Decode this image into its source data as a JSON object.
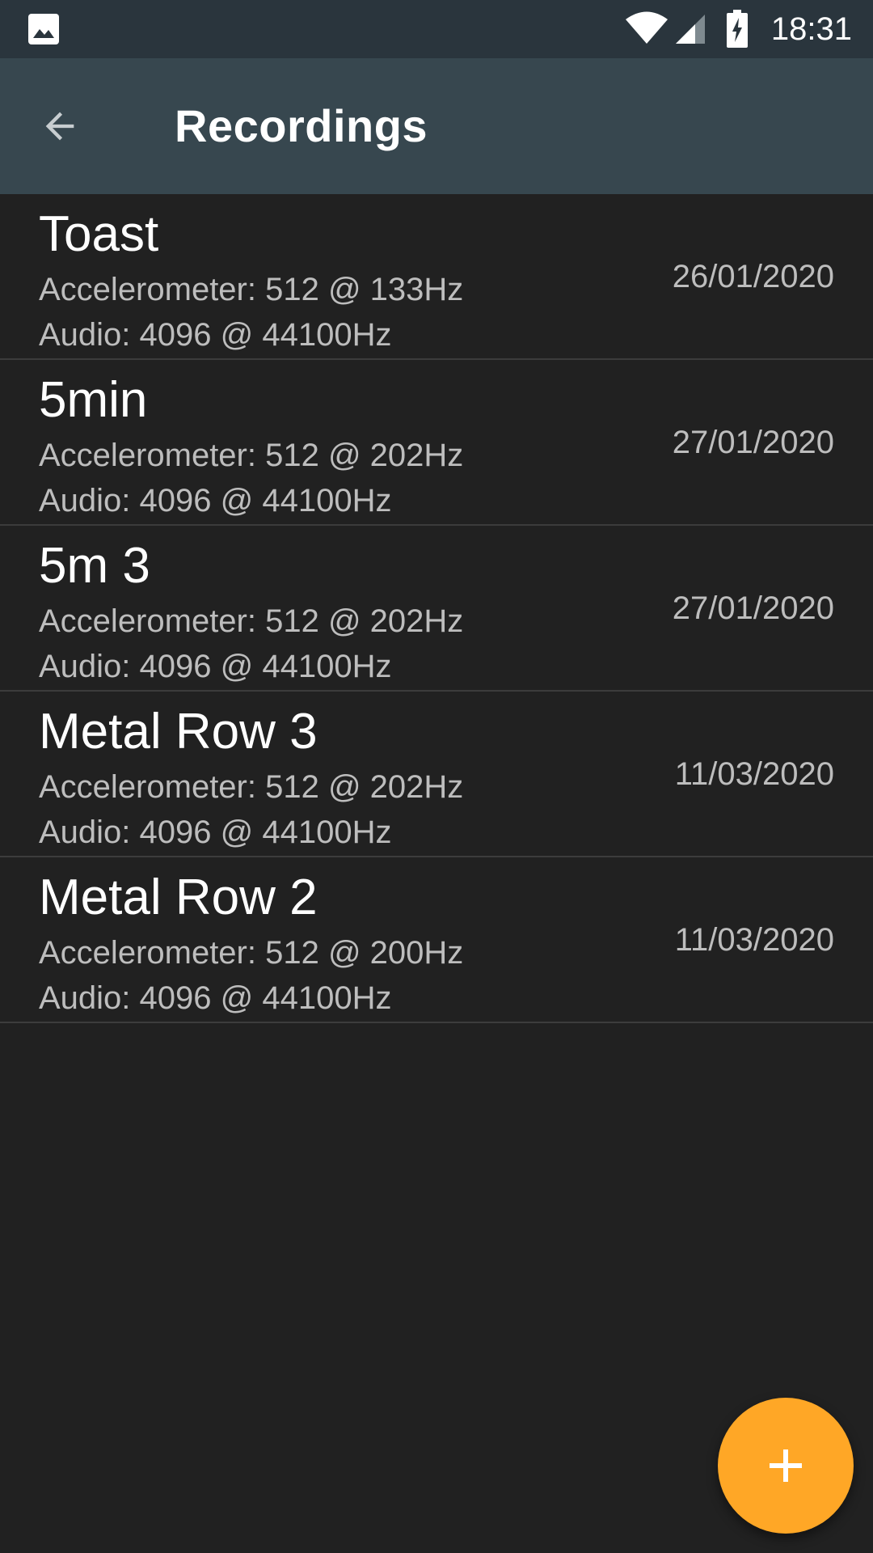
{
  "status_bar": {
    "time": "18:31",
    "icons": [
      "gallery-icon",
      "wifi-icon",
      "signal-icon",
      "battery-charging-icon"
    ]
  },
  "app_bar": {
    "title": "Recordings",
    "back_icon": "arrow-back-icon"
  },
  "recordings": [
    {
      "name": "Toast",
      "accelerometer": "Accelerometer: 512 @ 133Hz",
      "audio": "Audio: 4096 @ 44100Hz",
      "date": "26/01/2020"
    },
    {
      "name": "5min",
      "accelerometer": "Accelerometer: 512 @ 202Hz",
      "audio": "Audio: 4096 @ 44100Hz",
      "date": "27/01/2020"
    },
    {
      "name": "5m 3",
      "accelerometer": "Accelerometer: 512 @ 202Hz",
      "audio": "Audio: 4096 @ 44100Hz",
      "date": "27/01/2020"
    },
    {
      "name": "Metal Row 3",
      "accelerometer": "Accelerometer: 512 @ 202Hz",
      "audio": "Audio: 4096 @ 44100Hz",
      "date": "11/03/2020"
    },
    {
      "name": "Metal Row 2",
      "accelerometer": "Accelerometer: 512 @ 200Hz",
      "audio": "Audio: 4096 @ 44100Hz",
      "date": "11/03/2020"
    }
  ],
  "fab": {
    "icon": "plus-icon"
  },
  "colors": {
    "status_bar": "#2a353d",
    "app_bar": "#37474f",
    "background": "#212121",
    "fab": "#ffa726",
    "primary_text": "#ffffff",
    "secondary_text": "#bdbdbd",
    "divider": "#3c3c3c"
  }
}
